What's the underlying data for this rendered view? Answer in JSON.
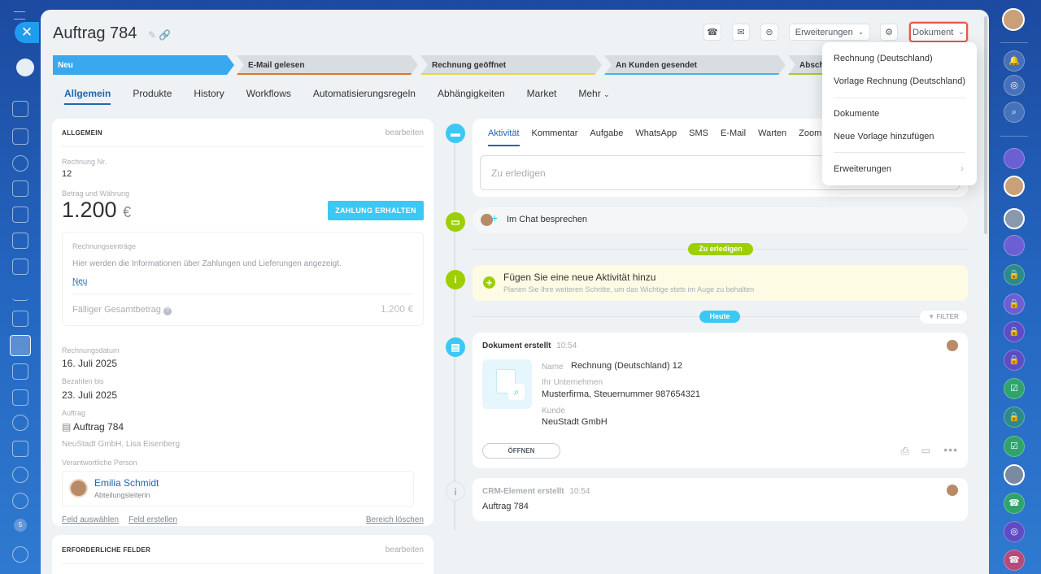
{
  "header": {
    "title": "Auftrag 784",
    "extensions_label": "Erweiterungen",
    "document_label": "Dokument"
  },
  "left_rail": {
    "badge": "5"
  },
  "stages": [
    {
      "label": "Neu",
      "color": "#39a8ef"
    },
    {
      "label": "E-Mail gelesen",
      "color": "#e2741f"
    },
    {
      "label": "Rechnung geöffnet",
      "color": "#e3d44a"
    },
    {
      "label": "An Kunden gesendet",
      "color": "#47b2e8"
    },
    {
      "label": "Abschlie",
      "color": "#9bcf3b"
    }
  ],
  "tabs": [
    "Allgemein",
    "Produkte",
    "History",
    "Workflows",
    "Automatisierungsregeln",
    "Abhängigkeiten",
    "Market",
    "Mehr"
  ],
  "general": {
    "heading": "ALLGEMEIN",
    "edit": "bearbeiten",
    "invoice_no_label": "Rechnung Nr.",
    "invoice_no": "12",
    "amount_label": "Betrag und Währung",
    "amount": "1.200",
    "currency": "€",
    "pay_button": "ZAHLUNG ERHALTEN",
    "entries_label": "Rechnungseinträge",
    "entries_text": "Hier werden die Informationen über Zahlungen und Lieferungen angezeigt.",
    "entries_new": "Neu",
    "total_label": "Fälliger Gesamtbetrag",
    "total_value": "1.200 €",
    "date_label": "Rechnungsdatum",
    "date_value": "16. Juli 2025",
    "due_label": "Bezahlen bis",
    "due_value": "23. Juli 2025",
    "order_label": "Auftrag",
    "order_value": "Auftrag 784",
    "order_sub": "NeuStadt GmbH, Lisa Eisenberg",
    "responsible_label": "Verantwortliche Person",
    "responsible_name": "Emilia Schmidt",
    "responsible_role": "Abteilungsleiterin",
    "select_field": "Feld auswählen",
    "create_field": "Feld erstellen",
    "delete_section": "Bereich löschen"
  },
  "required": {
    "heading": "ERFORDERLICHE FELDER",
    "edit": "bearbeiten"
  },
  "activity": {
    "tabs": [
      "Aktivität",
      "Kommentar",
      "Aufgabe",
      "WhatsApp",
      "SMS",
      "E-Mail",
      "Warten",
      "Zoom"
    ],
    "placeholder": "Zu erledigen",
    "chat_label": "Im Chat besprechen",
    "todo_pill": "Zu erledigen",
    "add_title": "Fügen Sie eine neue Aktivität hinzu",
    "add_sub": "Planen Sie Ihre weiteren Schritte, um das Wichtige stets im Auge zu behalten",
    "today_pill": "Heute",
    "filter": "FILTER",
    "doc_title": "Dokument erstellt",
    "doc_time": "10:54",
    "doc_name_label": "Name",
    "doc_name": "Rechnung (Deutschland) 12",
    "doc_company_label": "Ihr Unternehmen",
    "doc_company": "Musterfirma, Steuernummer 987654321",
    "doc_client_label": "Kunde",
    "doc_client": "NeuStadt GmbH",
    "open_button": "ÖFFNEN",
    "crm_title": "CRM-Element erstellt",
    "crm_time": "10:54",
    "crm_item": "Auftrag 784"
  },
  "menu": {
    "items": [
      "Rechnung (Deutschland)",
      "Vorlage Rechnung (Deutschland)",
      "Dokumente",
      "Neue Vorlage hinzufügen",
      "Erweiterungen"
    ]
  },
  "colors": {
    "accent": "#2067b0",
    "pay": "#3bc8f5",
    "green": "#9dcf00",
    "doc_highlight": "#e05a4a"
  }
}
